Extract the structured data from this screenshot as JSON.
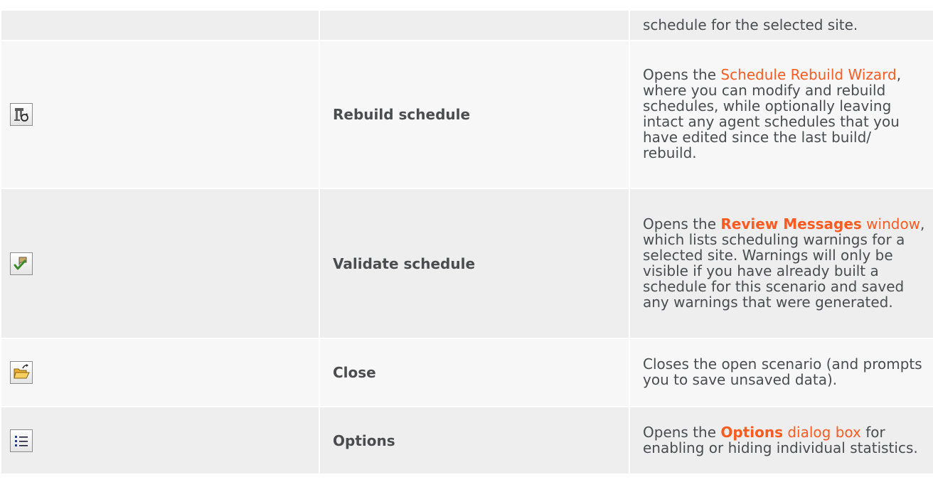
{
  "rows": [
    {
      "icon": null,
      "name": "",
      "desc_text": "schedule for the selected site."
    },
    {
      "icon": "rebuild-schedule-icon",
      "name": "Rebuild schedule",
      "desc_pre": "Opens the ",
      "desc_link": "Schedule Rebuild Wizard",
      "desc_post": ", where you can modify and rebuild schedules, while optionally leaving intact any agent schedules that you have edited since the last build/ rebuild."
    },
    {
      "icon": "validate-schedule-icon",
      "name": "Validate schedule",
      "desc_pre": "Opens the ",
      "desc_link_bold": "Review Messages",
      "desc_link_rest": " window",
      "desc_post": ", which lists scheduling warnings for a selected site. Warnings will only be visible if you have already built a schedule for this scenario and saved any warnings that were generated."
    },
    {
      "icon": "close-folder-icon",
      "name": "Close",
      "desc_text": "Closes the open scenario (and prompts you to save unsaved data)."
    },
    {
      "icon": "options-list-icon",
      "name": "Options",
      "desc_pre": "Opens the ",
      "desc_link_bold": "Options",
      "desc_link_rest": " dialog box",
      "desc_post": " for enabling or hiding individual statistics."
    }
  ],
  "colors": {
    "link": "#ff5a1f",
    "row_odd": "#eeeeee",
    "row_even": "#f7f7f7",
    "text": "#4a4c50"
  }
}
